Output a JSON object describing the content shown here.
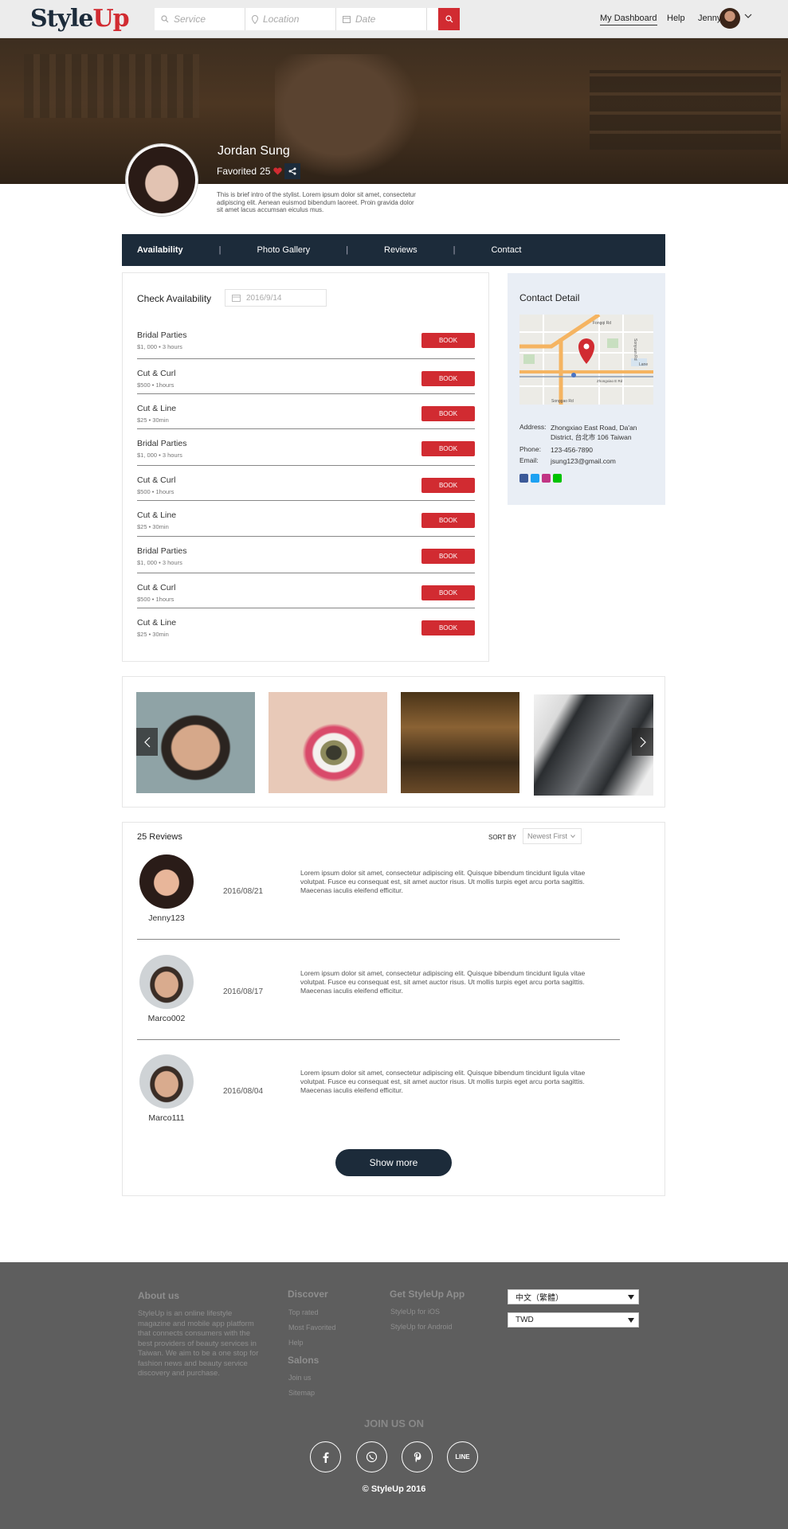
{
  "header": {
    "logo_part1": "Style",
    "logo_part2": "Up",
    "search": {
      "service": "Service",
      "location": "Location",
      "date": "Date"
    },
    "nav": {
      "dashboard": "My Dashboard",
      "help": "Help",
      "user": "Jenny"
    }
  },
  "profile": {
    "name": "Jordan Sung",
    "favorited_label": "Favorited",
    "favorited_count": "25",
    "intro": "This is brief intro of the stylist. Lorem ipsum dolor sit amet, consectetur adipiscing elit. Aenean euismod bibendum laoreet. Proin gravida dolor sit amet lacus accumsan eiculus mus."
  },
  "tabs": [
    "Availability",
    "Photo Gallery",
    "Reviews",
    "Contact"
  ],
  "availability": {
    "title": "Check Availability",
    "date": "2016/9/14",
    "book_label": "BOOK",
    "services": [
      {
        "name": "Bridal Parties",
        "meta": "$1, 000 • 3 hours"
      },
      {
        "name": "Cut & Curl",
        "meta": "$500 • 1hours"
      },
      {
        "name": "Cut & Line",
        "meta": "$25 • 30min"
      },
      {
        "name": "Bridal Parties",
        "meta": "$1, 000 • 3 hours"
      },
      {
        "name": "Cut & Curl",
        "meta": "$500 • 1hours"
      },
      {
        "name": "Cut & Line",
        "meta": "$25 • 30min"
      },
      {
        "name": "Bridal Parties",
        "meta": "$1, 000 • 3 hours"
      },
      {
        "name": "Cut & Curl",
        "meta": "$500 • 1hours"
      },
      {
        "name": "Cut & Line",
        "meta": "$25 • 30min"
      }
    ]
  },
  "contact": {
    "title": "Contact Detail",
    "map_labels": [
      "Fongqi Rd",
      "Sonyuan Rd",
      "Lane",
      "Songgao Rd",
      "Zhongxiao E Rd"
    ],
    "address_label": "Address:",
    "address": "Zhongxiao East Road, Da'an District, 台北市 106 Taiwan",
    "phone_label": "Phone:",
    "phone": "123-456-7890",
    "email_label": "Email:",
    "email": "jsung123@gmail.com"
  },
  "reviews": {
    "title": "25 Reviews",
    "sort_label": "SORT BY",
    "sort_value": "Newest First",
    "items": [
      {
        "user": "Jenny123",
        "date": "2016/08/21",
        "text": "Lorem ipsum dolor sit amet, consectetur adipiscing elit. Quisque bibendum tincidunt ligula vitae volutpat. Fusce eu consequat est, sit amet auctor risus. Ut mollis turpis eget arcu porta sagittis. Maecenas iaculis eleifend efficitur."
      },
      {
        "user": "Marco002",
        "date": "2016/08/17",
        "text": "Lorem ipsum dolor sit amet, consectetur adipiscing elit. Quisque bibendum tincidunt ligula vitae volutpat. Fusce eu consequat est, sit amet auctor risus. Ut mollis turpis eget arcu porta sagittis. Maecenas iaculis eleifend efficitur."
      },
      {
        "user": "Marco111",
        "date": "2016/08/04",
        "text": "Lorem ipsum dolor sit amet, consectetur adipiscing elit. Quisque bibendum tincidunt ligula vitae volutpat. Fusce eu consequat est, sit amet auctor risus. Ut mollis turpis eget arcu porta sagittis. Maecenas iaculis eleifend efficitur."
      }
    ],
    "show_more": "Show more"
  },
  "footer": {
    "about_title": "About us",
    "about_text": "StyleUp is an online lifestyle magazine and mobile app platform that connects consumers with the best providers of beauty services in Taiwan. We aim to be a one stop for fashion news and beauty service discovery and purchase.",
    "discover_title": "Discover",
    "discover_links": [
      "Top rated",
      "Most Favorited",
      "Help"
    ],
    "salons_title": "Salons",
    "salons_links": [
      "Join us",
      "Sitemap"
    ],
    "app_title": "Get StyleUp App",
    "app_links": [
      "StyleUp for iOS",
      "StyleUp for Android"
    ],
    "language": "中文（繁體）",
    "currency": "TWD",
    "join_title": "JOIN US ON",
    "line_label": "LINE",
    "copyright": "© StyleUp 2016"
  },
  "colors": {
    "accent": "#d12b31",
    "navy": "#1c2b3a",
    "footer": "#5e5e5e"
  }
}
